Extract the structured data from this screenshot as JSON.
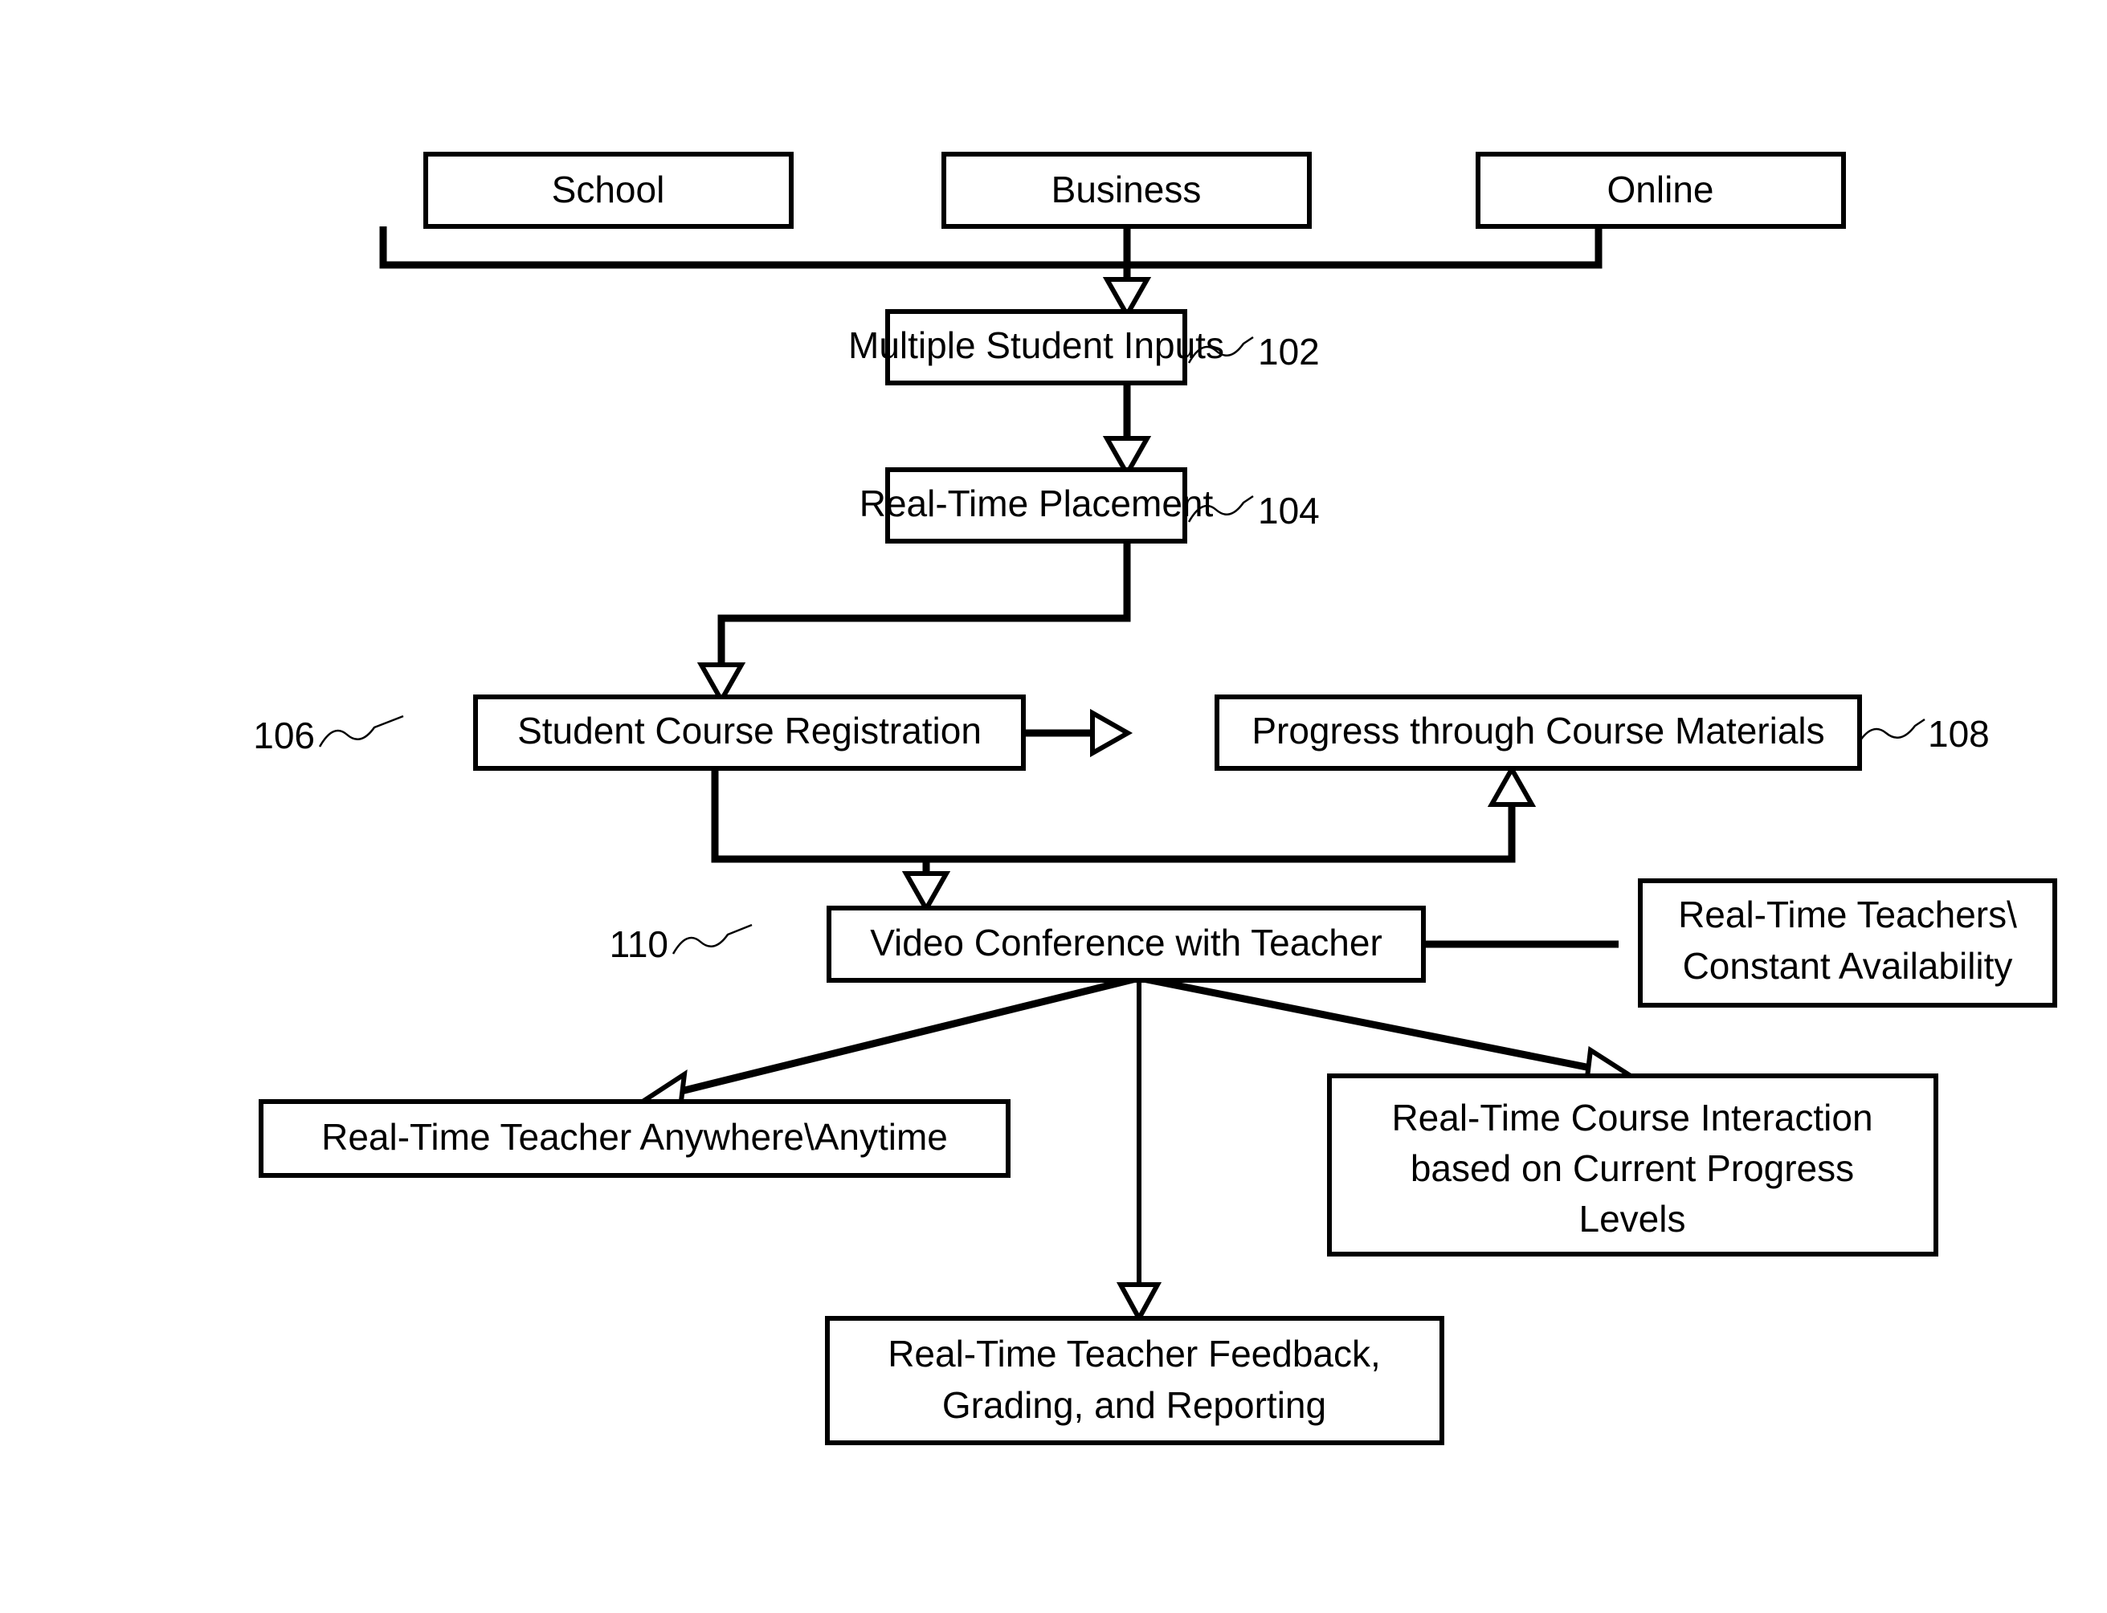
{
  "figure": {
    "type": "flowchart",
    "title": "Real-Time Online Education Flow Diagram",
    "background_color": "#ffffff",
    "line_color": "#000000"
  },
  "nodes": {
    "school": {
      "label": "School"
    },
    "business": {
      "label": "Business"
    },
    "online": {
      "label": "Online"
    },
    "multiple_student_inputs": {
      "label": "Multiple Student Inputs"
    },
    "real_time_placement": {
      "label": "Real-Time Placement"
    },
    "student_course_registration": {
      "label": "Student Course Registration"
    },
    "progress_through_course_materials": {
      "label": "Progress through Course Materials"
    },
    "video_conference_with_teacher": {
      "label": "Video Conference with Teacher"
    },
    "real_time_teachers": {
      "line1": "Real-Time Teachers\\",
      "line2": "Constant Availability"
    },
    "teacher_anywhere_anytime": {
      "label": "Real-Time Teacher Anywhere\\Anytime"
    },
    "course_interaction": {
      "line1": "Real-Time Course Interaction",
      "line2": "based on Current Progress",
      "line3": "Levels"
    },
    "teacher_feedback": {
      "line1": "Real-Time Teacher Feedback,",
      "line2": "Grading, and Reporting"
    }
  },
  "reference_numerals": {
    "multiple_student_inputs": "102",
    "real_time_placement": "104",
    "student_course_registration": "106",
    "progress_through_course_materials": "108",
    "video_conference_with_teacher": "110"
  }
}
